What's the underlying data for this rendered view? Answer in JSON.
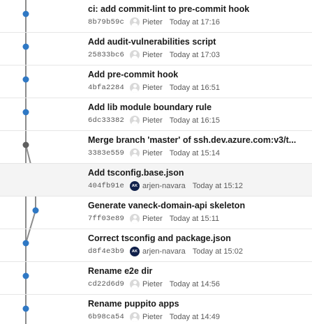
{
  "colors": {
    "branch_main": "#2f78c4",
    "merge_node": "#5f5f5f",
    "line": "#8c8c8c",
    "selected_row_bg": "#f4f4f4"
  },
  "graph": {
    "lanes": [
      "main",
      "feature"
    ],
    "selected_index": 5
  },
  "commits": [
    {
      "message": "ci: add commit-lint to pre-commit hook",
      "hash": "8b79b59c",
      "author": "Pieter",
      "avatar": "person-icon",
      "time": "Today at 17:16",
      "lane": "main",
      "merge": false
    },
    {
      "message": "Add audit-vulnerabilities script",
      "hash": "25833bc6",
      "author": "Pieter",
      "avatar": "person-icon",
      "time": "Today at 17:03",
      "lane": "main",
      "merge": false
    },
    {
      "message": "Add pre-commit hook",
      "hash": "4bfa2284",
      "author": "Pieter",
      "avatar": "person-icon",
      "time": "Today at 16:51",
      "lane": "main",
      "merge": false
    },
    {
      "message": "Add lib module boundary rule",
      "hash": "6dc33382",
      "author": "Pieter",
      "avatar": "person-icon",
      "time": "Today at 16:15",
      "lane": "main",
      "merge": false
    },
    {
      "message": "Merge branch 'master' of ssh.dev.azure.com:v3/t...",
      "hash": "3383e559",
      "author": "Pieter",
      "avatar": "person-icon",
      "time": "Today at 15:14",
      "lane": "main",
      "merge": true
    },
    {
      "message": "Add tsconfig.base.json",
      "hash": "404fb91e",
      "author": "arjen-navara",
      "avatar": "AK",
      "time": "Today at 15:12",
      "lane": "main",
      "merge": false
    },
    {
      "message": "Generate vaneck-domain-api skeleton",
      "hash": "7ff03e89",
      "author": "Pieter",
      "avatar": "person-icon",
      "time": "Today at 15:11",
      "lane": "feature",
      "merge": false
    },
    {
      "message": "Correct tsconfig and package.json",
      "hash": "d8f4e3b9",
      "author": "arjen-navara",
      "avatar": "AK",
      "time": "Today at 15:02",
      "lane": "main",
      "merge": false
    },
    {
      "message": "Rename e2e dir",
      "hash": "cd22d6d9",
      "author": "Pieter",
      "avatar": "person-icon",
      "time": "Today at 14:56",
      "lane": "main",
      "merge": false
    },
    {
      "message": "Rename puppito apps",
      "hash": "6b98ca54",
      "author": "Pieter",
      "avatar": "person-icon",
      "time": "Today at 14:49",
      "lane": "main",
      "merge": false
    }
  ]
}
